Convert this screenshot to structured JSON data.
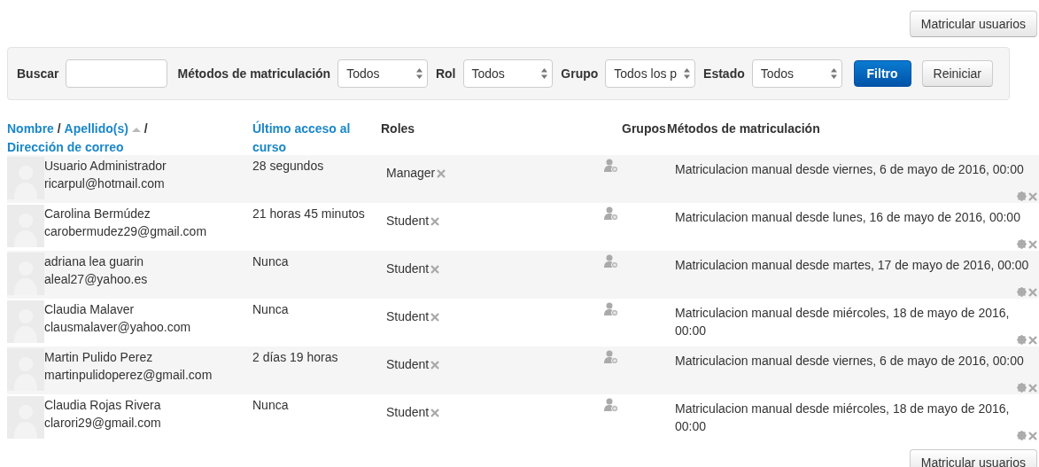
{
  "top_button": "Matricular usuarios",
  "filter": {
    "search_label": "Buscar",
    "selects": [
      {
        "label": "Métodos de matriculación",
        "value": "Todos"
      },
      {
        "label": "Rol",
        "value": "Todos"
      },
      {
        "label": "Grupo",
        "value": "Todos los p"
      },
      {
        "label": "Estado",
        "value": "Todos"
      }
    ],
    "filter_button": "Filtro",
    "reset_button": "Reiniciar"
  },
  "table": {
    "header_1": [
      {
        "kind": "link",
        "text": "Nombre"
      },
      {
        "kind": "sep",
        "text": "/"
      },
      {
        "kind": "link",
        "text": "Apellido(s)",
        "sorted": true
      },
      {
        "kind": "sep",
        "text": "/"
      },
      {
        "kind": "link",
        "text": "Dirección de correo"
      }
    ],
    "header_2": [
      {
        "kind": "link",
        "text": "Último acceso al curso"
      }
    ],
    "header_3": [
      {
        "kind": "plain",
        "text": "Roles"
      }
    ],
    "header_4": [
      {
        "kind": "plain",
        "text": "Grupos"
      }
    ],
    "header_5": [
      {
        "kind": "plain",
        "text": "Métodos de matriculación"
      }
    ],
    "rows": [
      {
        "name": "Usuario Administrador",
        "email": "ricarpul@hotmail.com",
        "last_access": "28 segundos",
        "roles": [
          "Manager"
        ],
        "method": "Matriculacion manual desde viernes, 6 de mayo de 2016, 00:00"
      },
      {
        "name": "Carolina Bermúdez",
        "email": "carobermudez29@gmail.com",
        "last_access": "21 horas 45 minutos",
        "roles": [
          "Student"
        ],
        "method": "Matriculacion manual desde lunes, 16 de mayo de 2016, 00:00"
      },
      {
        "name": "adriana lea guarin",
        "email": "aleal27@yahoo.es",
        "last_access": "Nunca",
        "roles": [
          "Student"
        ],
        "method": "Matriculacion manual desde martes, 17 de mayo de 2016, 00:00"
      },
      {
        "name": "Claudia Malaver",
        "email": "clausmalaver@yahoo.com",
        "last_access": "Nunca",
        "roles": [
          "Student"
        ],
        "method": "Matriculacion manual desde miércoles, 18 de mayo de 2016, 00:00"
      },
      {
        "name": "Martin Pulido Perez",
        "email": "martinpulidoperez@gmail.com",
        "last_access": "2 días 19 horas",
        "roles": [
          "Student"
        ],
        "method": "Matriculacion manual desde viernes, 6 de mayo de 2016, 00:00"
      },
      {
        "name": "Claudia Rojas Rivera",
        "email": "clarori29@gmail.com",
        "last_access": "Nunca",
        "roles": [
          "Student"
        ],
        "method": "Matriculacion manual desde miércoles, 18 de mayo de 2016, 00:00"
      }
    ]
  },
  "bottom_button": "Matricular usuarios"
}
